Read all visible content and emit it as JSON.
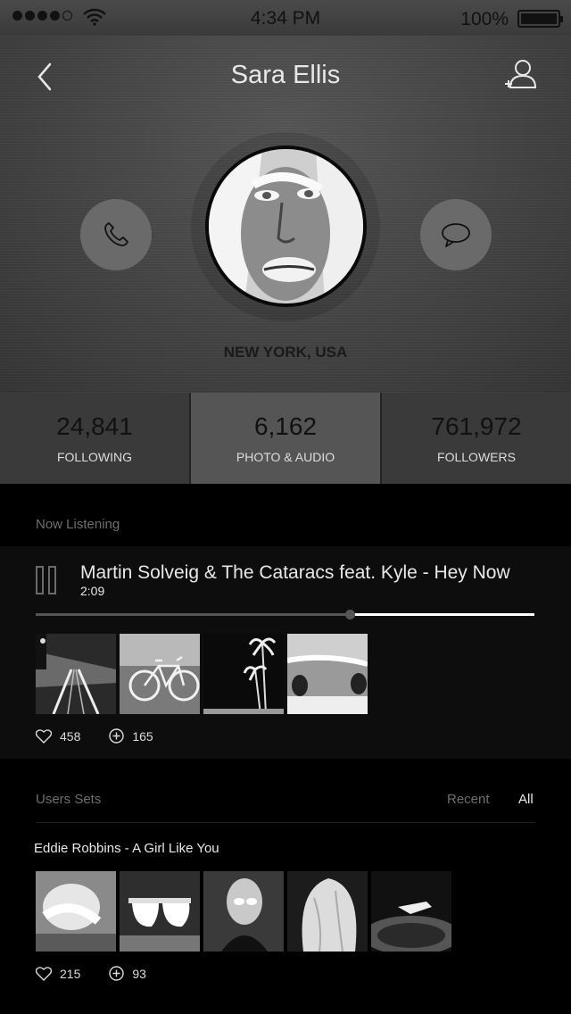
{
  "status_bar": {
    "time": "4:34 PM",
    "battery": "100%",
    "signal_bars": 4
  },
  "header": {
    "title": "Sara Ellis",
    "back_icon": "chevron-left-icon",
    "add_user_icon": "add-user-icon"
  },
  "profile": {
    "location": "NEW YORK, USA",
    "call_icon": "phone-icon",
    "message_icon": "chat-bubble-icon"
  },
  "stats": [
    {
      "value": "24,841",
      "label": "FOLLOWING"
    },
    {
      "value": "6,162",
      "label": "PHOTO & AUDIO"
    },
    {
      "value": "761,972",
      "label": "FOLLOWERS"
    }
  ],
  "now_listening": {
    "label": "Now Listening",
    "song": "Martin Solveig & The Cataracs feat. Kyle - Hey Now",
    "duration": "2:09",
    "progress": 0.63,
    "likes": "458",
    "adds": "165"
  },
  "users_sets": {
    "label": "Users Sets",
    "filters": {
      "recent": "Recent",
      "all": "All"
    },
    "set_title": "Eddie Robbins - A Girl Like You",
    "likes": "215",
    "adds": "93"
  },
  "colors": {
    "background": "#000000",
    "panel": "#0d0d0d",
    "accent": "#ffffff",
    "muted": "#6e6e6e"
  }
}
